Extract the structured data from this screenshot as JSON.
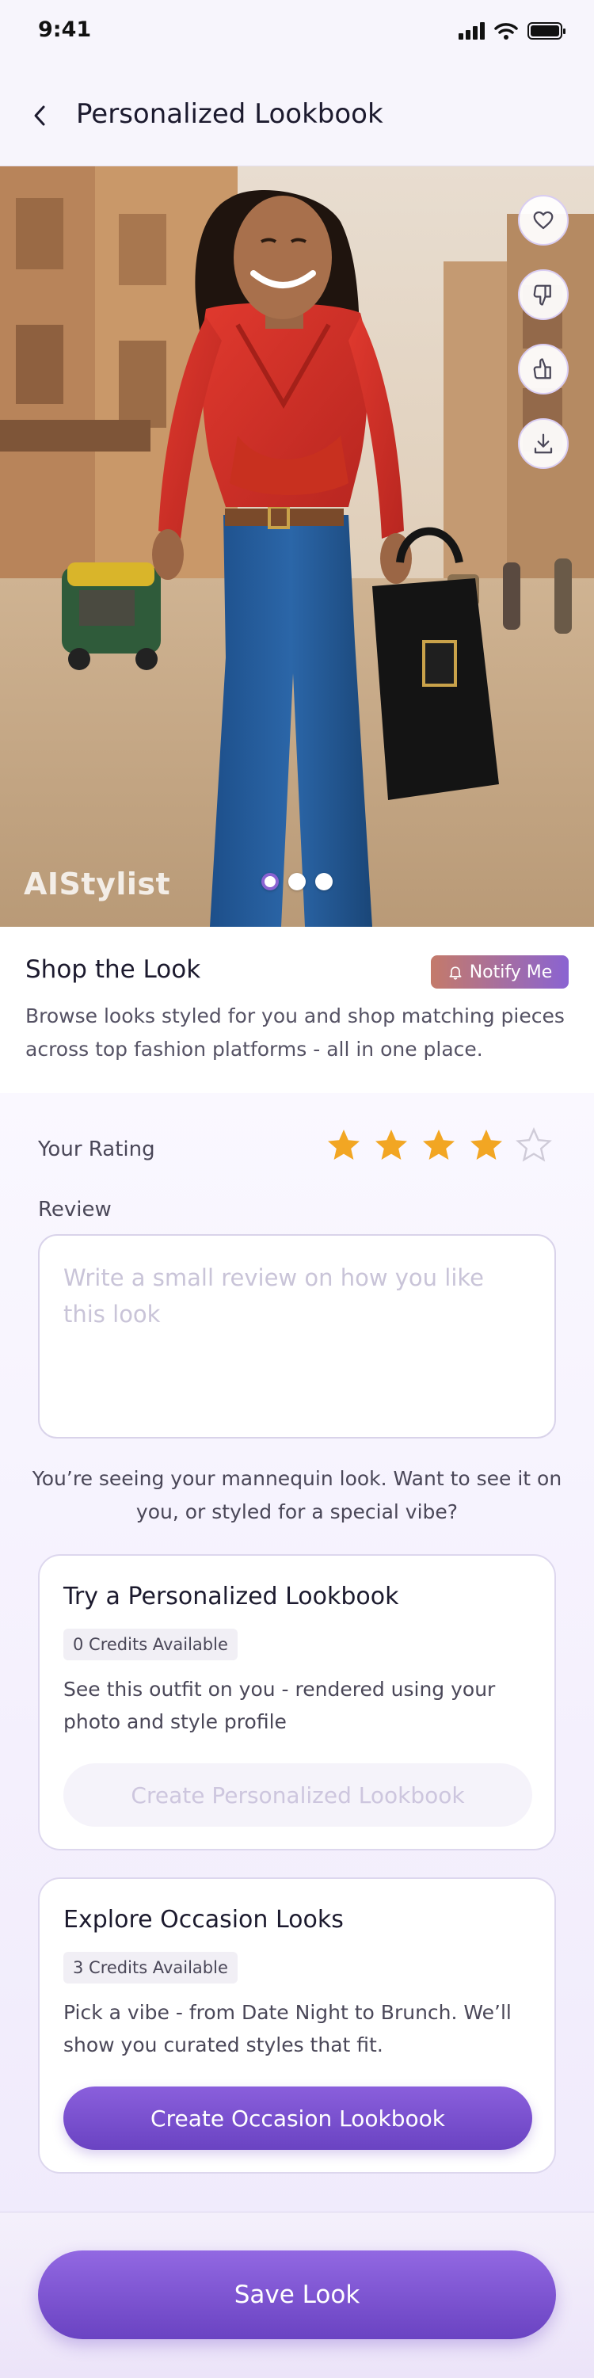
{
  "status_bar": {
    "time": "9:41"
  },
  "header": {
    "title": "Personalized Lookbook",
    "back_icon": "chevron-left-icon"
  },
  "hero": {
    "watermark": "AIStylist",
    "carousel": {
      "total": 3,
      "active": 1
    },
    "side_actions": [
      "heart-icon",
      "thumbs-down-icon",
      "thumbs-up-icon",
      "download-icon"
    ]
  },
  "shop": {
    "title": "Shop the Look",
    "notify_label": "Notify Me",
    "description": "Browse looks styled for you and shop matching pieces across top fashion platforms - all in one place."
  },
  "rating": {
    "label": "Your Rating",
    "value": 4,
    "max": 5,
    "star_color": "#f2a623"
  },
  "review": {
    "label": "Review",
    "placeholder": "Write a small review on how you like this look"
  },
  "prompt": "You’re seeing your mannequin look. Want to see it on you, or styled for a special vibe?",
  "cards": {
    "personalized": {
      "title": "Try a Personalized Lookbook",
      "credits": "0 Credits Available",
      "description": "See this outfit on you - rendered using your photo and style profile",
      "button": "Create Personalized Lookbook"
    },
    "occasion": {
      "title": "Explore Occasion Looks",
      "credits": "3 Credits Available",
      "description": "Pick a vibe - from Date Night to Brunch. We’ll show you curated styles that fit.",
      "button": "Create Occasion Lookbook"
    }
  },
  "footer": {
    "save_label": "Save Look"
  },
  "colors": {
    "accent": "#7b52d0",
    "notify_start": "#c47a6a"
  }
}
